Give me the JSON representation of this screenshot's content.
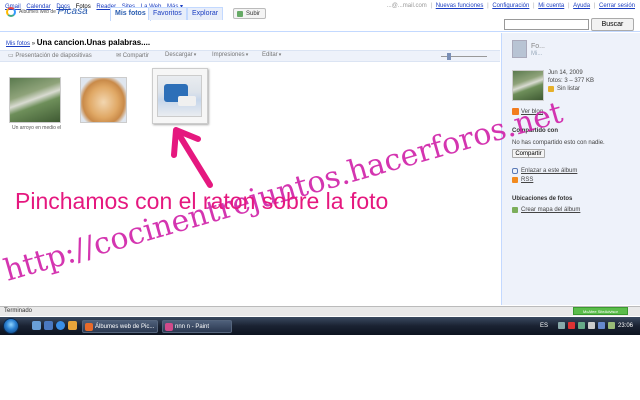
{
  "gbar": {
    "left_links": [
      "Gmail",
      "Calendar",
      "Docs",
      "Fotos",
      "Reader",
      "Sites",
      "La Web",
      "Más ▾"
    ],
    "current_link": "Fotos",
    "account_email": "...@...mail.com",
    "right_links": [
      "Nuevas funciones",
      "Configuración",
      "Mi cuenta",
      "Ayuda",
      "Cerrar sesión"
    ]
  },
  "header": {
    "logo_small": "Álbumes web de",
    "logo_big": "Picasa",
    "tabs": [
      "Mis fotos",
      "Favoritos",
      "Explorar"
    ],
    "active_tab": "Mis fotos",
    "upload_label": "Subir",
    "search_placeholder": "",
    "search_button": "Buscar"
  },
  "breadcrumb": {
    "root": "Mis fotos",
    "sep": "»",
    "album_title": "Una cancion.Unas palabras...."
  },
  "toolbar": {
    "slideshow": "Presentación de diapositivas",
    "share": "Compartir",
    "download": "Descargar",
    "prints": "Impresiones",
    "edit": "Editar"
  },
  "photos": {
    "caption1": "Un arroyo en medio el"
  },
  "sidebar": {
    "owner_name": "Fo...",
    "owner_link": "Mi...",
    "date": "Jun 14, 2009",
    "fotos": "fotos: 3 – 377 KB",
    "listar": "Sin listar",
    "blog": "Ver blog",
    "shared_head": "Compartido con",
    "shared_text": "No has compartido esto con nadie.",
    "share_button": "Compartir",
    "link_album": "Enlazar a este álbum",
    "rss": "RSS",
    "locations_head": "Ubicaciones de fotos",
    "map": "Crear mapa del álbum"
  },
  "statusbar": {
    "text": "Terminado",
    "badge": "McAfee SiteAdvisor"
  },
  "taskbar": {
    "task1": "Álbumes web de Pic...",
    "task2": "nnn n - Paint",
    "lang": "ES",
    "clock": "23:06"
  },
  "overlay": {
    "watermark": "http://cocinentrejuntos.hacerforos.net",
    "annotation": "Pinchamos con el raton sobre la foto"
  },
  "colors": {
    "accent": "#1a3dc1",
    "annotation": "#e5187f",
    "watermark": "#d020a8",
    "sidebar_bg": "#eef2fa"
  }
}
